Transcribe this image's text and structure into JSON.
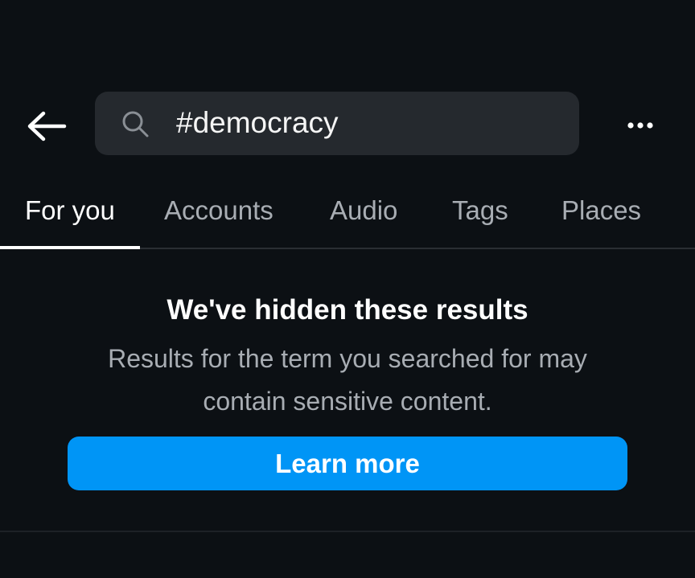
{
  "header": {
    "back_icon": "arrow-left-icon",
    "search": {
      "icon": "search-icon",
      "value": "#democracy"
    },
    "more_icon": "more-horizontal-icon"
  },
  "tabs": [
    {
      "label": "For you",
      "active": true
    },
    {
      "label": "Accounts",
      "active": false
    },
    {
      "label": "Audio",
      "active": false
    },
    {
      "label": "Tags",
      "active": false
    },
    {
      "label": "Places",
      "active": false
    }
  ],
  "notice": {
    "title": "We've hidden these results",
    "body": "Results for the term you searched for may contain sensitive content.",
    "button_label": "Learn more"
  },
  "colors": {
    "background": "#0c1014",
    "search_field": "#25292e",
    "primary_button": "#0095f6",
    "muted_text": "#a8adb3"
  }
}
